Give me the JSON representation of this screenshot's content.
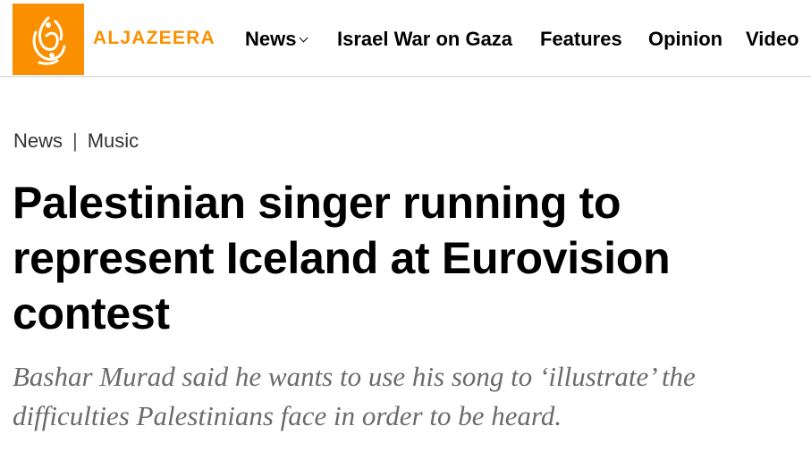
{
  "header": {
    "logo_icon": "aljazeera-calligraphy-logo-icon",
    "brand_name": "ALJAZEERA",
    "brand_color": "#fa9000",
    "nav": [
      {
        "label": "News",
        "has_dropdown": true
      },
      {
        "label": "Israel War on Gaza",
        "has_dropdown": false
      },
      {
        "label": "Features",
        "has_dropdown": false
      },
      {
        "label": "Opinion",
        "has_dropdown": false
      },
      {
        "label": "Video",
        "has_dropdown": false
      }
    ]
  },
  "breadcrumb": {
    "items": [
      "News",
      "Music"
    ],
    "separator": "|"
  },
  "article": {
    "title": "Palestinian singer running to represent Iceland at Eurovision contest",
    "subtitle": "Bashar Murad said he wants to use his song to ‘illustrate’ the difficulties Palestinians face in order to be heard."
  }
}
